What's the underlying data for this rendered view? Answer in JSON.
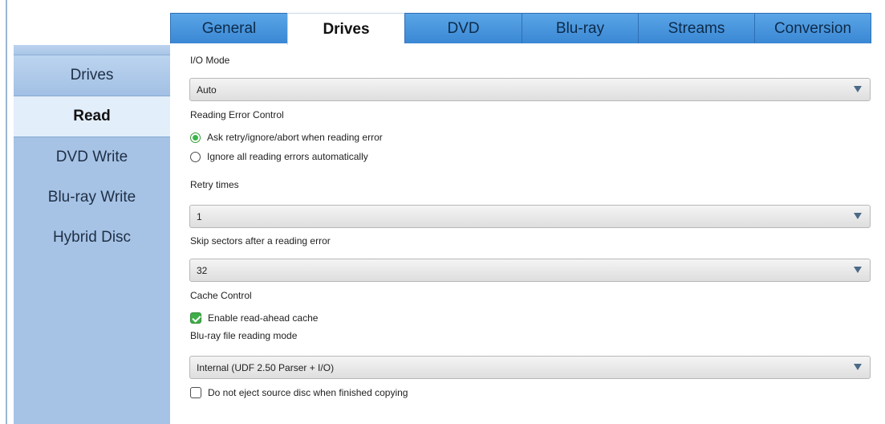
{
  "tabs": [
    {
      "label": "General"
    },
    {
      "label": "Drives",
      "active": true
    },
    {
      "label": "DVD"
    },
    {
      "label": "Blu-ray"
    },
    {
      "label": "Streams"
    },
    {
      "label": "Conversion"
    }
  ],
  "sidebar": {
    "items": [
      {
        "label": "Drives"
      },
      {
        "label": "Read",
        "active": true
      },
      {
        "label": "DVD Write"
      },
      {
        "label": "Blu-ray Write"
      },
      {
        "label": "Hybrid Disc"
      }
    ]
  },
  "settings": {
    "io_mode": {
      "label": "I/O Mode",
      "value": "Auto"
    },
    "reading_error_control": {
      "label": "Reading Error Control",
      "options": [
        {
          "label": "Ask retry/ignore/abort when reading error",
          "selected": true
        },
        {
          "label": "Ignore all reading errors automatically",
          "selected": false
        }
      ]
    },
    "retry_times": {
      "label": "Retry times",
      "value": "1"
    },
    "skip_sectors": {
      "label": "Skip sectors after a reading error",
      "value": "32"
    },
    "cache_control": {
      "label": "Cache Control",
      "read_ahead": {
        "label": "Enable read-ahead cache",
        "checked": true
      }
    },
    "bluray_reading_mode": {
      "label": "Blu-ray file reading mode",
      "value": "Internal (UDF 2.50 Parser + I/O)"
    },
    "do_not_eject": {
      "label": "Do not eject source disc when finished copying",
      "checked": false
    }
  },
  "colors": {
    "tab_active_bg": "#ffffff",
    "tab_bg": "#3a87d4",
    "sidebar_bg": "#a6c3e6",
    "sidebar_active_bg": "#e3eefb",
    "radio_selected": "#39b54a",
    "check_selected": "#3fae49"
  },
  "icons": {
    "dropdown": "chevron-down-icon",
    "radio_selected": "radio-selected-icon",
    "checkbox_checked": "checkmark-icon"
  }
}
